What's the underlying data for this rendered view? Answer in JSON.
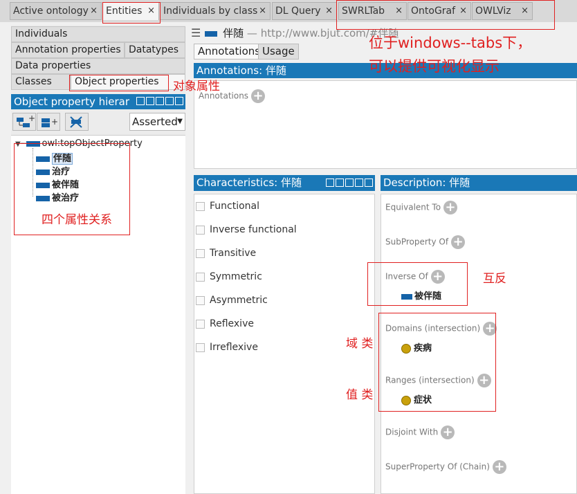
{
  "tabs": [
    {
      "label": "Active ontology",
      "close": "×"
    },
    {
      "label": "Entities",
      "close": "×"
    },
    {
      "label": "Individuals by class",
      "close": "×"
    },
    {
      "label": "DL Query",
      "close": "×"
    },
    {
      "label": "SWRLTab",
      "close": "×"
    },
    {
      "label": "OntoGraf",
      "close": "×"
    },
    {
      "label": "OWLViz",
      "close": "×"
    }
  ],
  "left_tabs": {
    "individuals": "Individuals",
    "annotation_properties": "Annotation properties",
    "datatypes": "Datatypes",
    "data_properties": "Data properties",
    "classes": "Classes",
    "object_properties": "Object properties"
  },
  "hierarchy": {
    "title": "Object property hierar",
    "dropdown": "Asserted",
    "root": "owl:topObjectProperty",
    "children": [
      "伴随",
      "治疗",
      "被伴随",
      "被治疗"
    ]
  },
  "entity": {
    "name": "伴随",
    "separator": "—",
    "iri": "http://www.bjut.com/#伴随"
  },
  "subtabs": {
    "annotations": "Annotations",
    "usage": "Usage"
  },
  "annotations_header": "Annotations: 伴随",
  "annotations_label": "Annotations",
  "characteristics_header": "Characteristics: 伴随",
  "characteristics": [
    "Functional",
    "Inverse functional",
    "Transitive",
    "Symmetric",
    "Asymmetric",
    "Reflexive",
    "Irreflexive"
  ],
  "description_header": "Description: 伴随",
  "description": {
    "equivalent_to": "Equivalent To",
    "subproperty_of": "SubProperty Of",
    "inverse_of": "Inverse Of",
    "inverse_value": "被伴随",
    "domains": "Domains (intersection)",
    "domain_value": "疾病",
    "ranges": "Ranges (intersection)",
    "range_value": "症状",
    "disjoint_with": "Disjoint With",
    "superproperty_chain": "SuperProperty Of (Chain)"
  },
  "annotations_red": {
    "tabs_note_line1": "位于windows--tabs下，",
    "tabs_note_line2": "可以提供可视化显示",
    "object_properties_note": "对象属性",
    "four_relations_note": "四个属性关系",
    "inverse_note": "互反",
    "domain_note": "域 类",
    "range_note": "值 类"
  },
  "colors": {
    "accent": "#1a78b7",
    "annotation_red": "#e02020",
    "property_blue": "#1563a8",
    "class_dot": "#c9a10c"
  }
}
